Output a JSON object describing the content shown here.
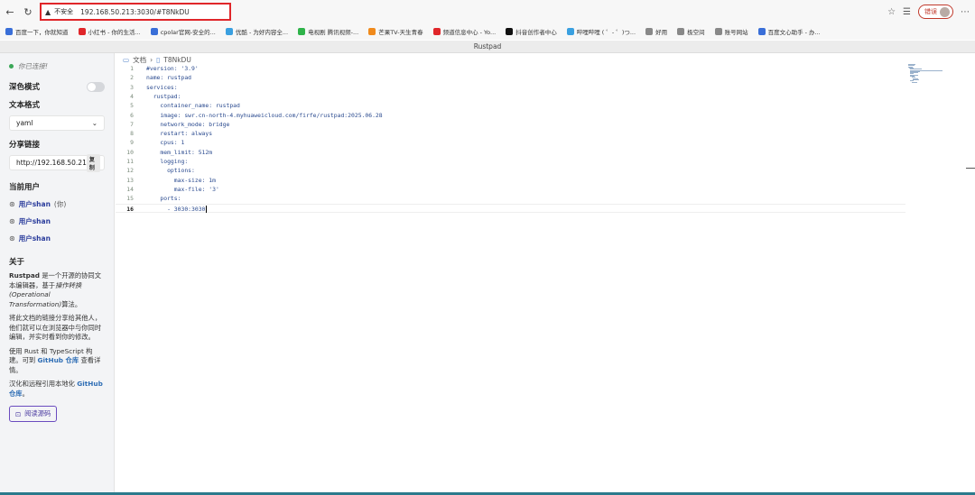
{
  "browser": {
    "insecure_label": "不安全",
    "url": "192.168.50.213:3030/#T8NkDU",
    "error_label": "错误",
    "bookmarks": [
      {
        "label": "百度一下，你就知道",
        "color": "#3a6fd8"
      },
      {
        "label": "小红书 - 你的生活...",
        "color": "#e0262a"
      },
      {
        "label": "cpolar官网-安全的...",
        "color": "#3a6fd8"
      },
      {
        "label": "优酷 - 为好内容全...",
        "color": "#3aa0e0"
      },
      {
        "label": "电视剧 腾讯视频-...",
        "color": "#2fb34a"
      },
      {
        "label": "芒果TV-天生青春",
        "color": "#f08a1c"
      },
      {
        "label": "频道信息中心 - Yo...",
        "color": "#e0262a"
      },
      {
        "label": "抖音创作者中心",
        "color": "#111111"
      },
      {
        "label": "哔哩哔哩 ( ゜- ゜)つ...",
        "color": "#3aa0e0"
      },
      {
        "label": "好用",
        "color": "#888888"
      },
      {
        "label": "极空间",
        "color": "#888888"
      },
      {
        "label": "账号网站",
        "color": "#888888"
      },
      {
        "label": "百度文心助手 - 办...",
        "color": "#3a6fd8"
      }
    ]
  },
  "window": {
    "title": "Rustpad"
  },
  "sidebar": {
    "status": "你已连接!",
    "dark_mode_label": "深色模式",
    "format_label": "文本格式",
    "format_value": "yaml",
    "share_label": "分享链接",
    "share_value": "http://192.168.50.21",
    "copy_label": "复制",
    "users_label": "当前用户",
    "users": [
      {
        "name": "用户shan",
        "suffix": "(你)"
      },
      {
        "name": "用户shan",
        "suffix": ""
      },
      {
        "name": "用户shan",
        "suffix": ""
      }
    ],
    "about_label": "关于",
    "about_p1_name": "Rustpad",
    "about_p1_a": " 是一个开源的协同文本编辑器，基于",
    "about_p1_em": "操作转换 (Operational Transformation)",
    "about_p1_b": "算法。",
    "about_p2": "将此文档的链接分享给其他人，他们就可以在浏览器中与你同时编辑，并实时看到你的修改。",
    "about_p3_a": "使用 Rust 和 TypeScript 构建。可到 ",
    "about_p3_link": "GitHub 仓库",
    "about_p3_b": " 查看详情。",
    "about_p4_a": "汉化和远程引用本地化 ",
    "about_p4_link": "GitHub 仓库",
    "about_p4_b": "。",
    "read_source_label": "阅读源码"
  },
  "main": {
    "breadcrumb_root": "文档",
    "breadcrumb_doc": "T8NkDU",
    "code_lines": [
      "#version: '3.9'",
      "name: rustpad",
      "services:",
      "  rustpad:",
      "    container_name: rustpad",
      "    image: swr.cn-north-4.myhuaweicloud.com/firfe/rustpad:2025.06.28",
      "    network_mode: bridge",
      "    restart: always",
      "    cpus: 1",
      "    mem_limit: 512m",
      "    logging:",
      "      options:",
      "        max-size: 1m",
      "        max-file: '3'",
      "    ports:",
      "      - 3030:3030"
    ],
    "active_line": 16
  }
}
